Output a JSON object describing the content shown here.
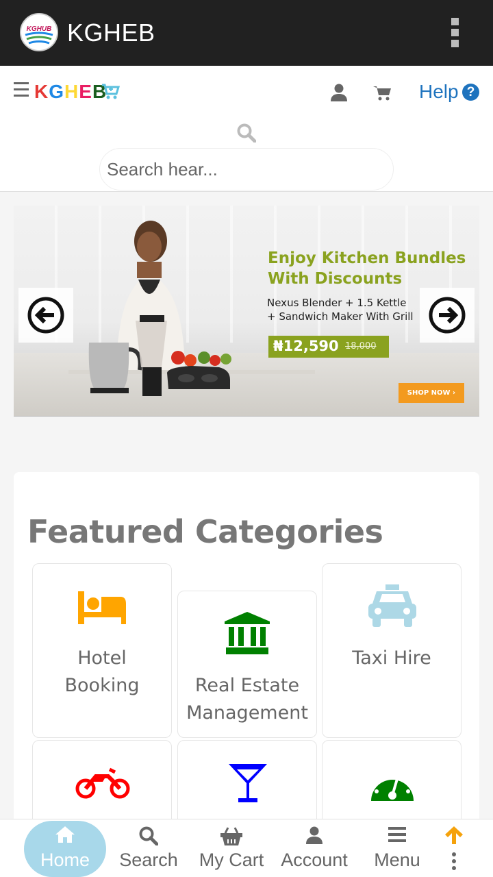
{
  "app_bar": {
    "title": "KGHEB",
    "logo_icon": "kghub-logo-icon",
    "more_icon": "more-vertical-icon"
  },
  "header": {
    "brand": [
      "K",
      "G",
      "H",
      "E",
      "B"
    ],
    "brand_icon": "cart-icon",
    "help_label": "Help",
    "help_icon": "?"
  },
  "search": {
    "placeholder": "Search hear..."
  },
  "banner": {
    "headline_line1": "Enjoy Kitchen Bundles",
    "headline_line2": "With Discounts",
    "desc_line1": "Nexus Blender + 1.5 Kettle",
    "desc_line2": "+ Sandwich Maker With Grill",
    "price": "₦12,590",
    "old_price": "18,000",
    "cta": "SHOP NOW ›",
    "accent_color": "#8aa21f",
    "cta_color": "#f39a1f"
  },
  "featured": {
    "title": "Featured Categories",
    "categories": [
      {
        "line1": "Hotel",
        "line2": "Booking",
        "icon": "bed-icon",
        "color": "#ffa500"
      },
      {
        "line1": "Real Estate",
        "line2": "Management",
        "icon": "bank-icon",
        "color": "#008000"
      },
      {
        "line1": "Taxi Hire",
        "line2": "",
        "icon": "taxi-icon",
        "color": "#add8e6"
      },
      {
        "line1": "",
        "line2": "",
        "icon": "motorcycle-icon",
        "color": "#ff0000"
      },
      {
        "line1": "",
        "line2": "",
        "icon": "cocktail-icon",
        "color": "#0000ff"
      },
      {
        "line1": "",
        "line2": "",
        "icon": "dashboard-icon",
        "color": "#008000"
      }
    ]
  },
  "bottom_nav": {
    "items": [
      {
        "label": "Home",
        "icon": "home-icon"
      },
      {
        "label": "Search",
        "icon": "search-icon"
      },
      {
        "label": "My Cart",
        "icon": "basket-icon"
      },
      {
        "label": "Account",
        "icon": "user-icon"
      },
      {
        "label": "Menu",
        "icon": "menu-icon"
      }
    ],
    "scroll_top_icon": "arrow-up-icon",
    "active_color": "#a8d8ea"
  }
}
